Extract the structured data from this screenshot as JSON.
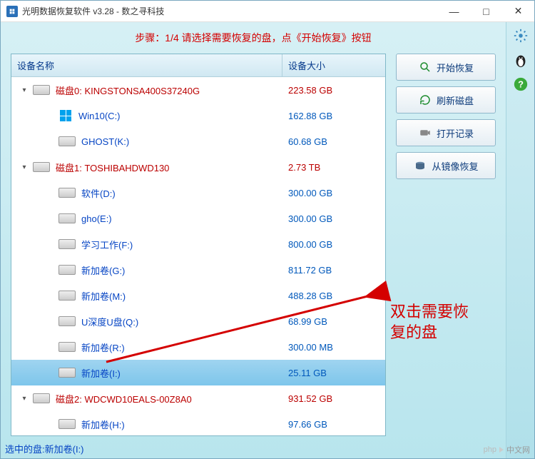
{
  "window": {
    "title": "光明数据恢复软件 v3.28 - 数之寻科技"
  },
  "banner": "步骤：1/4 请选择需要恢复的盘，点《开始恢复》按钮",
  "columns": {
    "name": "设备名称",
    "size": "设备大小"
  },
  "devices": [
    {
      "label": "磁盘0: KINGSTONSA400S37240G",
      "size": "223.58 GB",
      "volumes": [
        {
          "label": "Win10(C:)",
          "size": "162.88 GB",
          "win": true
        },
        {
          "label": "GHOST(K:)",
          "size": "60.68 GB"
        }
      ]
    },
    {
      "label": "磁盘1: TOSHIBAHDWD130",
      "size": "2.73 TB",
      "volumes": [
        {
          "label": "软件(D:)",
          "size": "300.00 GB"
        },
        {
          "label": "gho(E:)",
          "size": "300.00 GB"
        },
        {
          "label": "学习工作(F:)",
          "size": "800.00 GB"
        },
        {
          "label": "新加卷(G:)",
          "size": "811.72 GB"
        },
        {
          "label": "新加卷(M:)",
          "size": "488.28 GB"
        },
        {
          "label": "U深度U盘(Q:)",
          "size": "68.99 GB"
        },
        {
          "label": "新加卷(R:)",
          "size": "300.00 MB"
        },
        {
          "label": "新加卷(I:)",
          "size": "25.11 GB",
          "selected": true
        }
      ]
    },
    {
      "label": "磁盘2: WDCWD10EALS-00Z8A0",
      "size": "931.52 GB",
      "volumes": [
        {
          "label": "新加卷(H:)",
          "size": "97.66 GB"
        }
      ]
    }
  ],
  "buttons": {
    "start": "开始恢复",
    "refresh": "刷新磁盘",
    "openlog": "打开记录",
    "fromimage": "从镜像恢复"
  },
  "annotation": "双击需要恢\n复的盘",
  "status_prefix": "选中的盘:",
  "status_value": "新加卷(I:)",
  "watermark": "中文网"
}
